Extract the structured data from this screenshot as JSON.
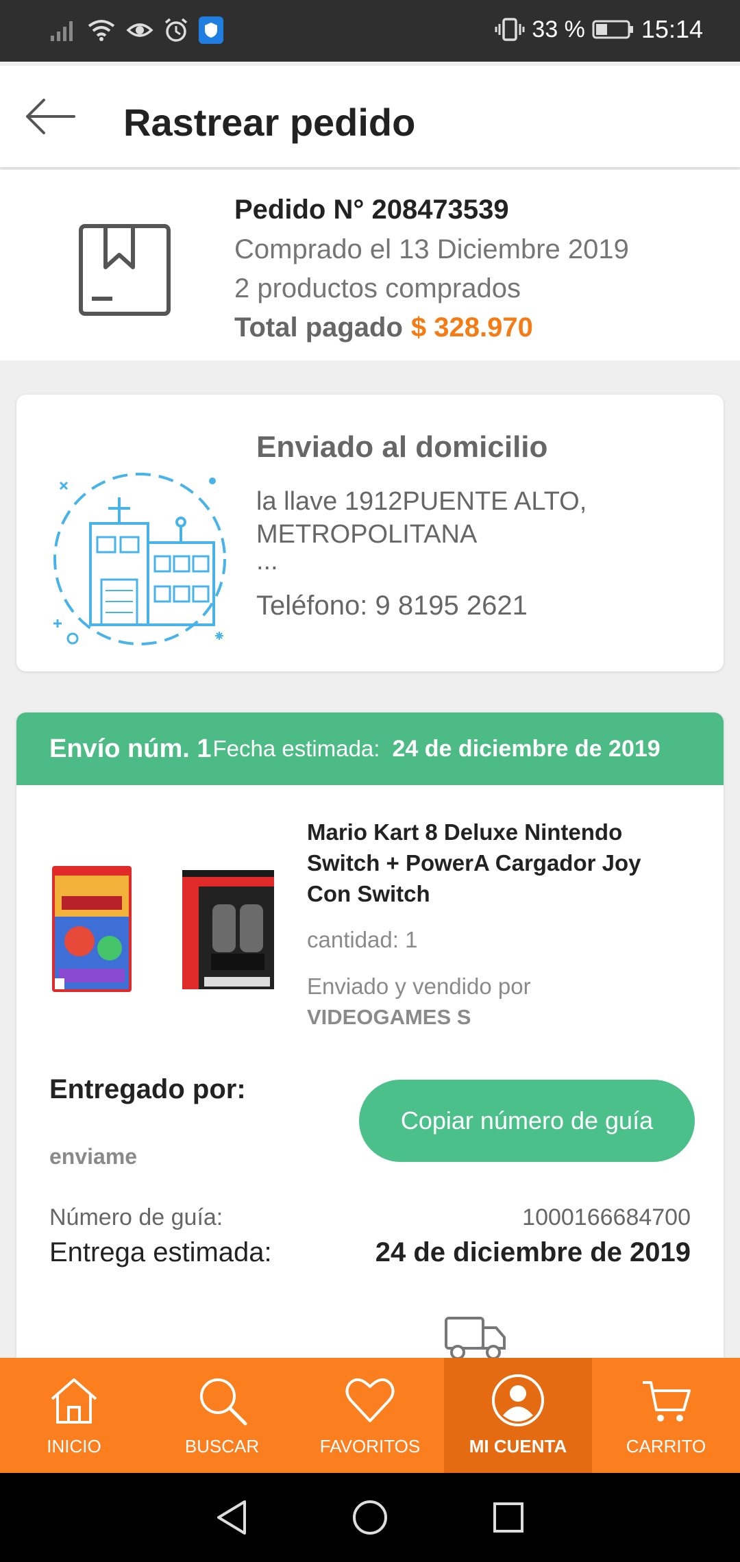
{
  "status_bar": {
    "battery_pct": "33 %",
    "time": "15:14"
  },
  "header": {
    "title": "Rastrear pedido"
  },
  "order": {
    "number": "Pedido N° 208473539",
    "purchased": "Comprado el 13 Diciembre 2019",
    "products": "2 productos comprados",
    "total_label": "Total pagado",
    "total_amount": "$ 328.970"
  },
  "address": {
    "title": "Enviado al domicilio",
    "line1": "la llave 1912PUENTE ALTO,",
    "line2": "METROPOLITANA",
    "ellipsis": "...",
    "phone": "Teléfono: 9 8195 2621"
  },
  "shipment": {
    "number_label": "Envío núm. 1",
    "date_label": "Fecha estimada:",
    "date_value": "24 de diciembre de 2019",
    "product_name": "Mario Kart 8 Deluxe Nintendo Switch + PowerA Cargador Joy Con Switch",
    "quantity": "cantidad: 1",
    "seller_label": "Enviado y vendido por",
    "seller_name": "VIDEOGAMES S",
    "delivered_by_label": "Entregado por:",
    "carrier": "enviame",
    "copy_button": "Copiar número de guía",
    "guia_label": "Número de guía:",
    "guia_value": "1000166684700",
    "eta_label": "Entrega estimada:",
    "eta_value": "24 de diciembre de 2019"
  },
  "bottom_nav": {
    "items": [
      {
        "label": "INICIO",
        "icon": "home-icon"
      },
      {
        "label": "BUSCAR",
        "icon": "search-icon"
      },
      {
        "label": "FAVORITOS",
        "icon": "heart-icon"
      },
      {
        "label": "MI CUENTA",
        "icon": "user-icon",
        "active": true
      },
      {
        "label": "CARRITO",
        "icon": "cart-icon"
      }
    ]
  },
  "colors": {
    "accent": "#fb7e1f",
    "green": "#4dbb85",
    "price": "#f57c15"
  }
}
